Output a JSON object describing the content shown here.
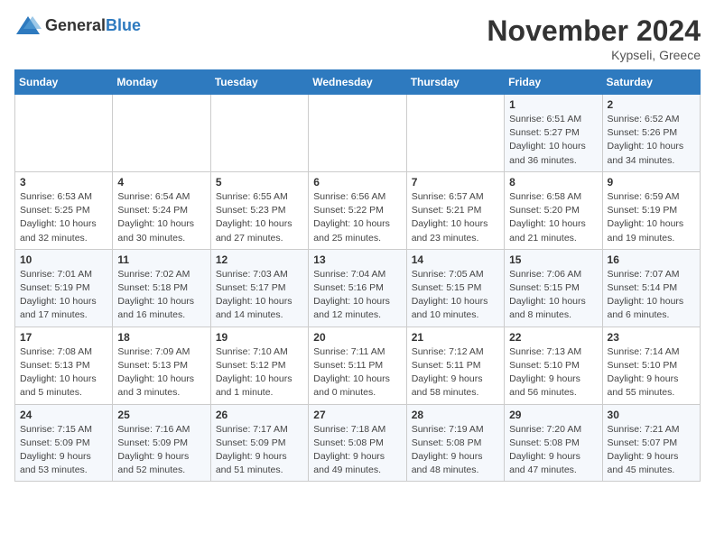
{
  "header": {
    "logo": {
      "general": "General",
      "blue": "Blue"
    },
    "title": "November 2024",
    "location": "Kypseli, Greece"
  },
  "calendar": {
    "days_of_week": [
      "Sunday",
      "Monday",
      "Tuesday",
      "Wednesday",
      "Thursday",
      "Friday",
      "Saturday"
    ],
    "weeks": [
      [
        {
          "day": "",
          "info": ""
        },
        {
          "day": "",
          "info": ""
        },
        {
          "day": "",
          "info": ""
        },
        {
          "day": "",
          "info": ""
        },
        {
          "day": "",
          "info": ""
        },
        {
          "day": "1",
          "info": "Sunrise: 6:51 AM\nSunset: 5:27 PM\nDaylight: 10 hours and 36 minutes."
        },
        {
          "day": "2",
          "info": "Sunrise: 6:52 AM\nSunset: 5:26 PM\nDaylight: 10 hours and 34 minutes."
        }
      ],
      [
        {
          "day": "3",
          "info": "Sunrise: 6:53 AM\nSunset: 5:25 PM\nDaylight: 10 hours and 32 minutes."
        },
        {
          "day": "4",
          "info": "Sunrise: 6:54 AM\nSunset: 5:24 PM\nDaylight: 10 hours and 30 minutes."
        },
        {
          "day": "5",
          "info": "Sunrise: 6:55 AM\nSunset: 5:23 PM\nDaylight: 10 hours and 27 minutes."
        },
        {
          "day": "6",
          "info": "Sunrise: 6:56 AM\nSunset: 5:22 PM\nDaylight: 10 hours and 25 minutes."
        },
        {
          "day": "7",
          "info": "Sunrise: 6:57 AM\nSunset: 5:21 PM\nDaylight: 10 hours and 23 minutes."
        },
        {
          "day": "8",
          "info": "Sunrise: 6:58 AM\nSunset: 5:20 PM\nDaylight: 10 hours and 21 minutes."
        },
        {
          "day": "9",
          "info": "Sunrise: 6:59 AM\nSunset: 5:19 PM\nDaylight: 10 hours and 19 minutes."
        }
      ],
      [
        {
          "day": "10",
          "info": "Sunrise: 7:01 AM\nSunset: 5:19 PM\nDaylight: 10 hours and 17 minutes."
        },
        {
          "day": "11",
          "info": "Sunrise: 7:02 AM\nSunset: 5:18 PM\nDaylight: 10 hours and 16 minutes."
        },
        {
          "day": "12",
          "info": "Sunrise: 7:03 AM\nSunset: 5:17 PM\nDaylight: 10 hours and 14 minutes."
        },
        {
          "day": "13",
          "info": "Sunrise: 7:04 AM\nSunset: 5:16 PM\nDaylight: 10 hours and 12 minutes."
        },
        {
          "day": "14",
          "info": "Sunrise: 7:05 AM\nSunset: 5:15 PM\nDaylight: 10 hours and 10 minutes."
        },
        {
          "day": "15",
          "info": "Sunrise: 7:06 AM\nSunset: 5:15 PM\nDaylight: 10 hours and 8 minutes."
        },
        {
          "day": "16",
          "info": "Sunrise: 7:07 AM\nSunset: 5:14 PM\nDaylight: 10 hours and 6 minutes."
        }
      ],
      [
        {
          "day": "17",
          "info": "Sunrise: 7:08 AM\nSunset: 5:13 PM\nDaylight: 10 hours and 5 minutes."
        },
        {
          "day": "18",
          "info": "Sunrise: 7:09 AM\nSunset: 5:13 PM\nDaylight: 10 hours and 3 minutes."
        },
        {
          "day": "19",
          "info": "Sunrise: 7:10 AM\nSunset: 5:12 PM\nDaylight: 10 hours and 1 minute."
        },
        {
          "day": "20",
          "info": "Sunrise: 7:11 AM\nSunset: 5:11 PM\nDaylight: 10 hours and 0 minutes."
        },
        {
          "day": "21",
          "info": "Sunrise: 7:12 AM\nSunset: 5:11 PM\nDaylight: 9 hours and 58 minutes."
        },
        {
          "day": "22",
          "info": "Sunrise: 7:13 AM\nSunset: 5:10 PM\nDaylight: 9 hours and 56 minutes."
        },
        {
          "day": "23",
          "info": "Sunrise: 7:14 AM\nSunset: 5:10 PM\nDaylight: 9 hours and 55 minutes."
        }
      ],
      [
        {
          "day": "24",
          "info": "Sunrise: 7:15 AM\nSunset: 5:09 PM\nDaylight: 9 hours and 53 minutes."
        },
        {
          "day": "25",
          "info": "Sunrise: 7:16 AM\nSunset: 5:09 PM\nDaylight: 9 hours and 52 minutes."
        },
        {
          "day": "26",
          "info": "Sunrise: 7:17 AM\nSunset: 5:09 PM\nDaylight: 9 hours and 51 minutes."
        },
        {
          "day": "27",
          "info": "Sunrise: 7:18 AM\nSunset: 5:08 PM\nDaylight: 9 hours and 49 minutes."
        },
        {
          "day": "28",
          "info": "Sunrise: 7:19 AM\nSunset: 5:08 PM\nDaylight: 9 hours and 48 minutes."
        },
        {
          "day": "29",
          "info": "Sunrise: 7:20 AM\nSunset: 5:08 PM\nDaylight: 9 hours and 47 minutes."
        },
        {
          "day": "30",
          "info": "Sunrise: 7:21 AM\nSunset: 5:07 PM\nDaylight: 9 hours and 45 minutes."
        }
      ]
    ]
  }
}
